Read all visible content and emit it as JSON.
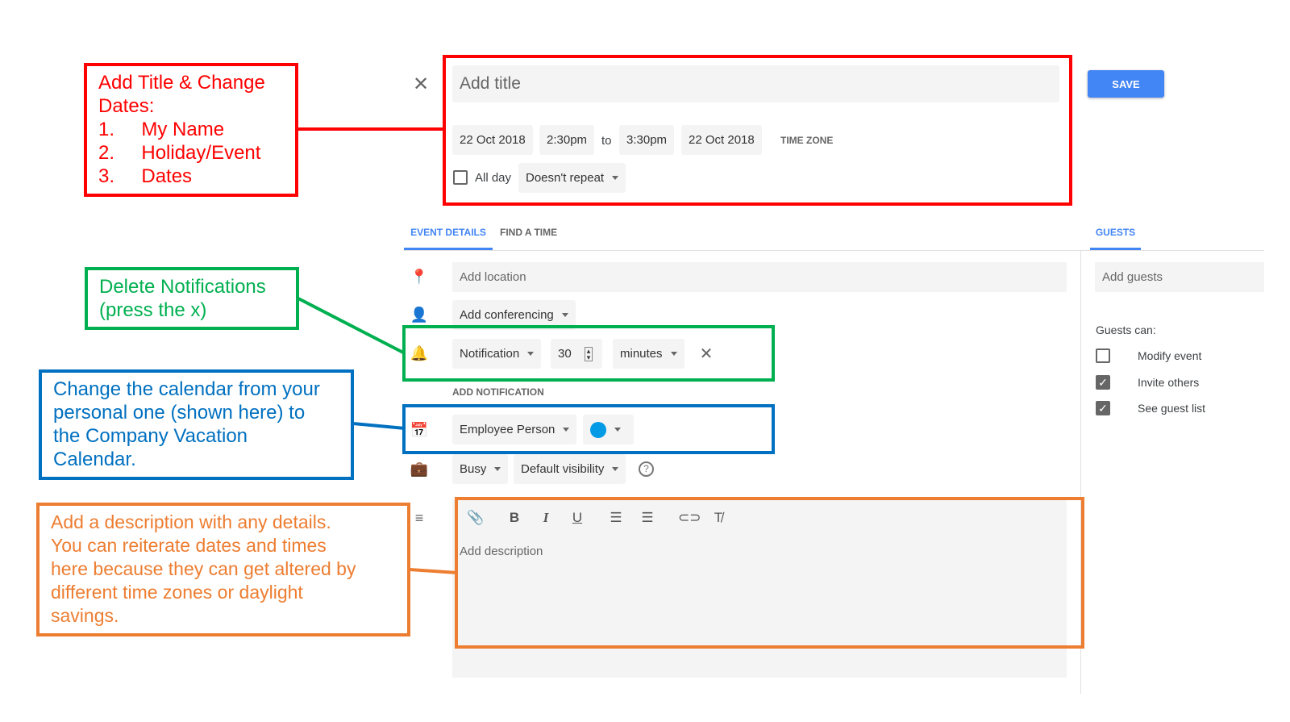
{
  "event": {
    "title_placeholder": "Add title",
    "start_date": "22 Oct 2018",
    "start_time": "2:30pm",
    "to": "to",
    "end_time": "3:30pm",
    "end_date": "22 Oct 2018",
    "time_zone": "TIME ZONE",
    "all_day": "All day",
    "all_day_checked": false,
    "repeat": "Doesn't repeat",
    "save": "SAVE"
  },
  "tabs": {
    "event_details": "EVENT DETAILS",
    "find_a_time": "FIND A TIME",
    "guests": "GUESTS"
  },
  "details": {
    "location_placeholder": "Add location",
    "conferencing": "Add conferencing",
    "notification_type": "Notification",
    "notification_value": "30",
    "notification_unit": "minutes",
    "add_notification": "ADD NOTIFICATION",
    "calendar": "Employee Person",
    "calendar_color": "#039be5",
    "availability": "Busy",
    "visibility": "Default visibility",
    "description_placeholder": "Add description"
  },
  "guests": {
    "placeholder": "Add guests",
    "guests_can": "Guests can:",
    "permissions": [
      {
        "label": "Modify event",
        "checked": false
      },
      {
        "label": "Invite others",
        "checked": true
      },
      {
        "label": "See guest list",
        "checked": true
      }
    ]
  },
  "annotations": {
    "red": [
      "Add Title & Change",
      "Dates:",
      "1.     My Name",
      "2.     Holiday/Event",
      "3.     Dates"
    ],
    "green": [
      "Delete Notifications",
      "(press the x)"
    ],
    "blue": [
      "Change the calendar from your",
      "personal one (shown here) to",
      "the Company Vacation",
      "Calendar."
    ],
    "orange": [
      "Add a description with any details.",
      "You can reiterate dates and times",
      "here because they can get altered by",
      "different time zones or daylight",
      "savings."
    ]
  },
  "colors": {
    "red": "#ff0000",
    "green": "#00b050",
    "blue": "#0070c0",
    "orange": "#ed7d31",
    "accent": "#4285f4"
  }
}
